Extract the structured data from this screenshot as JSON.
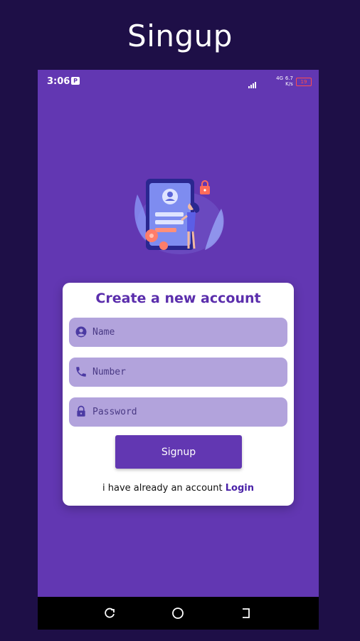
{
  "heading": "Singup",
  "status_bar": {
    "time": "3:06",
    "app_icon": "P",
    "network": "4G",
    "speed_value": "6.7",
    "speed_unit": "K/s",
    "battery": "19"
  },
  "card": {
    "title": "Create a new account",
    "fields": {
      "name": {
        "placeholder": "Name",
        "icon": "person-icon"
      },
      "number": {
        "placeholder": "Number",
        "icon": "phone-icon"
      },
      "password": {
        "placeholder": "Password",
        "icon": "lock-icon"
      }
    },
    "signup_label": "Signup",
    "login_prompt": "i have already an account",
    "login_link": "Login"
  },
  "nav": {
    "recent": "recent-apps-icon",
    "home": "home-icon",
    "back": "back-icon"
  },
  "colors": {
    "background": "#1e0f47",
    "screen": "#6237b2",
    "field": "#b2a3dc",
    "accent": "#5b2eac"
  }
}
